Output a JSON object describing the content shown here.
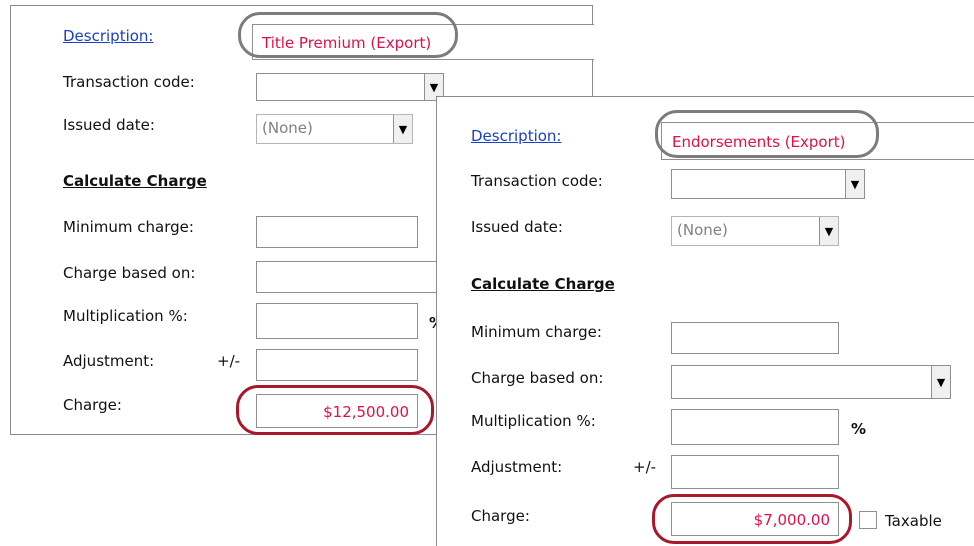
{
  "panel_left": {
    "description_label": "Description:",
    "description_value": "Title Premium (Export)",
    "transaction_code_label": "Transaction code:",
    "issued_date_label": "Issued date:",
    "issued_date_value": "(None)",
    "calculate_charge_heading": "Calculate Charge",
    "minimum_charge_label": "Minimum charge:",
    "charge_based_on_label": "Charge based on:",
    "multiplication_label": "Multiplication %:",
    "percent_symbol": "%",
    "adjustment_label": "Adjustment:",
    "plus_minus": "+/-",
    "charge_label": "Charge:",
    "charge_value": "$12,500.00"
  },
  "panel_right": {
    "description_label": "Description:",
    "description_value": "Endorsements (Export)",
    "transaction_code_label": "Transaction code:",
    "issued_date_label": "Issued date:",
    "issued_date_value": "(None)",
    "calculate_charge_heading": "Calculate Charge",
    "minimum_charge_label": "Minimum charge:",
    "charge_based_on_label": "Charge based on:",
    "multiplication_label": "Multiplication %:",
    "percent_symbol": "%",
    "adjustment_label": "Adjustment:",
    "plus_minus": "+/-",
    "charge_label": "Charge:",
    "charge_value": "$7,000.00",
    "taxable_label": "Taxable"
  },
  "icons": {
    "dropdown": "chevron-down-icon"
  },
  "colors": {
    "link": "#1a3fc4",
    "highlight_text": "#e0104a",
    "annotation_gray": "#7c7c7c",
    "annotation_red": "#a8182a"
  }
}
